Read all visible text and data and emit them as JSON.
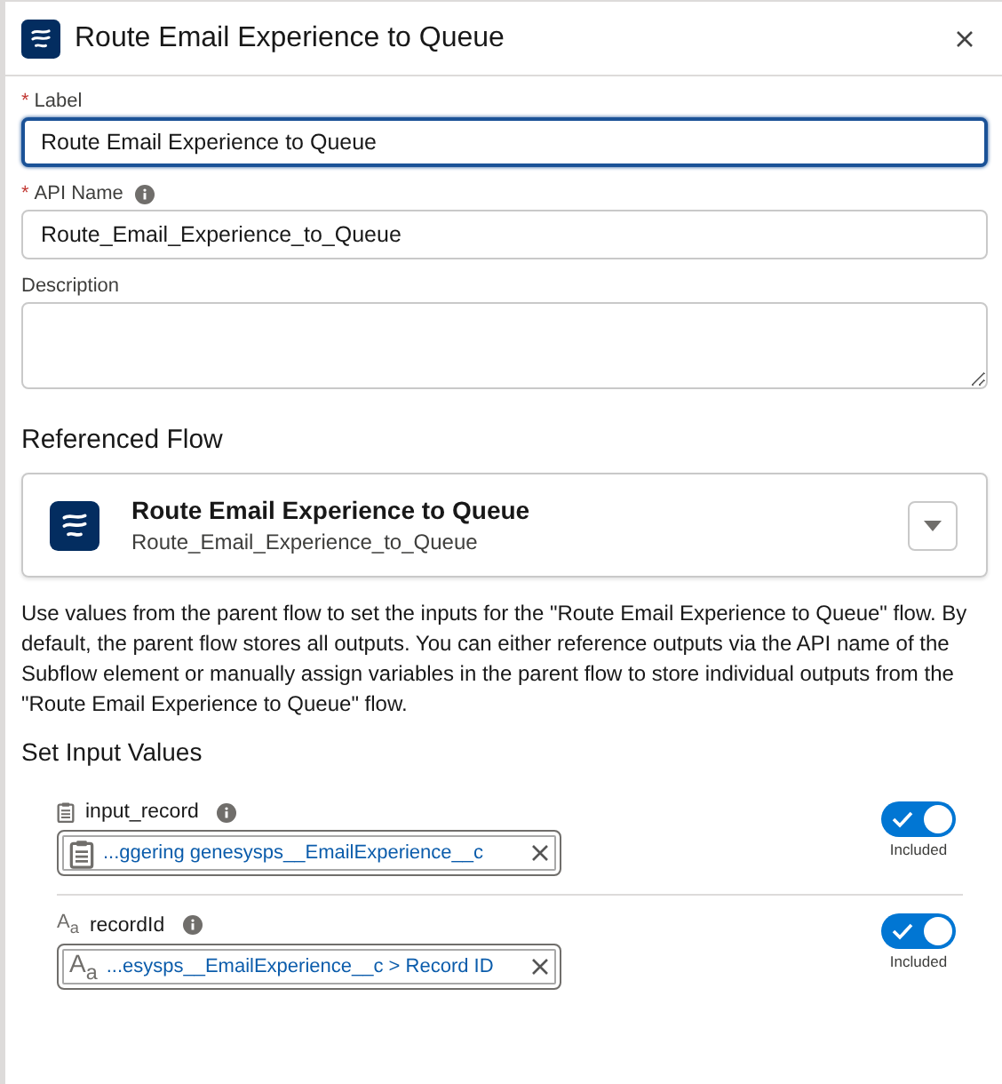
{
  "panel": {
    "title": "Route Email Experience to Queue"
  },
  "fields": [
    {
      "label": "Label",
      "required_mark": "*",
      "info": false,
      "value": "Route Email Experience to Queue",
      "focused": true,
      "kind": "input"
    },
    {
      "label": "API Name",
      "required_mark": "*",
      "info": true,
      "value": "Route_Email_Experience_to_Queue",
      "focused": false,
      "kind": "input"
    },
    {
      "label": "Description",
      "info": false,
      "focused": false,
      "kind": "textarea"
    }
  ],
  "referenced_flow": {
    "heading": "Referenced Flow",
    "name": "Route Email Experience to Queue",
    "api_name": "Route_Email_Experience_to_Queue"
  },
  "description": "Use values from the parent flow to set the inputs for the \"Route Email Experience to Queue\" flow. By default, the parent flow stores all outputs. You can either reference outputs via the API name of the Subflow element or manually assign variables in the parent flow to store individual outputs from the \"Route Email Experience to Queue\" flow.",
  "input_values": {
    "heading": "Set Input Values",
    "items": [
      {
        "name": "input_record",
        "kind": "record",
        "value": "...ggering genesysps__EmailExperience__c",
        "on": true,
        "toggle_label": "Included"
      },
      {
        "name": "recordId",
        "kind": "text",
        "type_glyph": "A$_{a}$",
        "value_glyph": "A$_{a}$",
        "value": "...esysps__EmailExperience__c > Record ID",
        "on": true,
        "toggle_label": "Included"
      }
    ]
  }
}
